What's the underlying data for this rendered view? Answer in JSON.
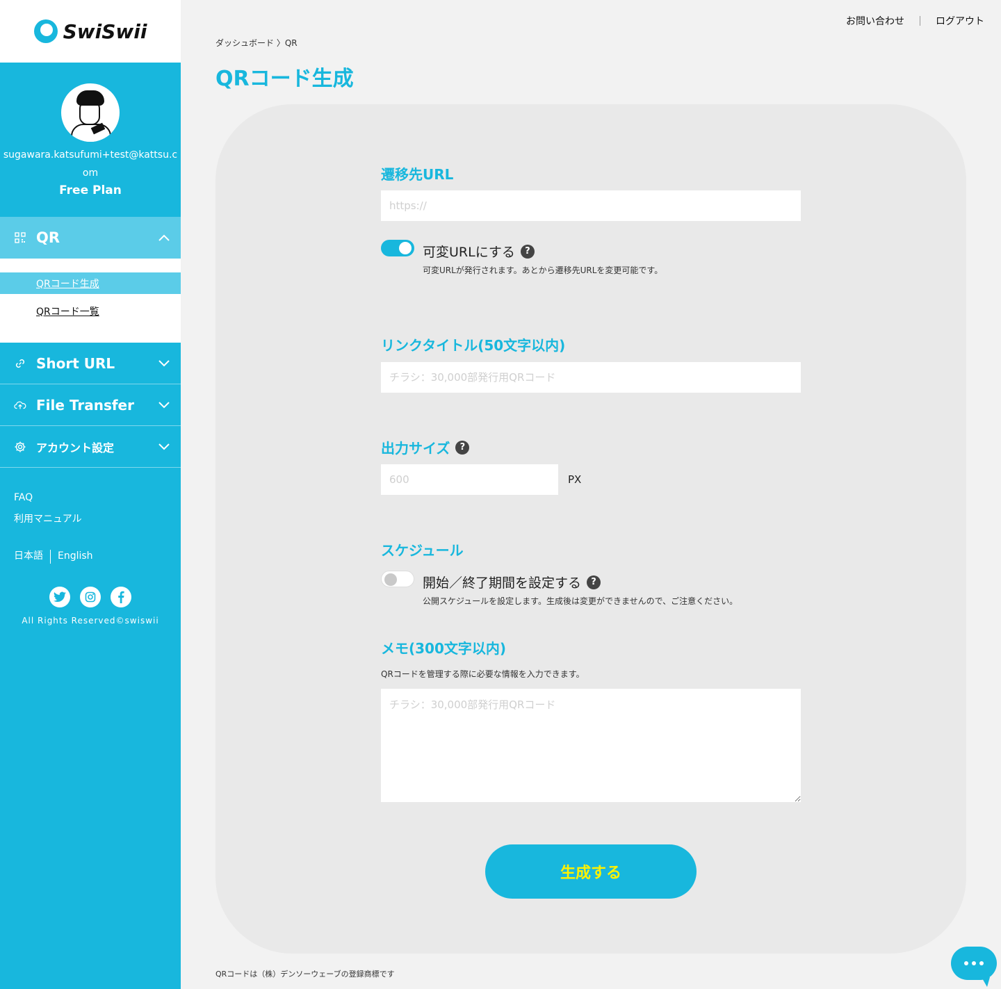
{
  "brand": {
    "name": "SwiSwii",
    "color": "#18b7dd"
  },
  "user": {
    "email": "sugawara.katsufumi+test@kattsu.com",
    "plan": "Free Plan"
  },
  "sidebar": {
    "qr": {
      "label": "QR",
      "icon": "qr-icon",
      "expanded": true
    },
    "qr_submenu": [
      {
        "label": "QRコード生成",
        "active": true
      },
      {
        "label": "QRコード一覧",
        "active": false
      }
    ],
    "items": [
      {
        "label": "Short URL",
        "icon": "link-icon"
      },
      {
        "label": "File Transfer",
        "icon": "cloud-upload-icon"
      },
      {
        "label": "アカウント設定",
        "icon": "gear-icon"
      }
    ],
    "links": [
      "FAQ",
      "利用マニュアル"
    ],
    "languages": [
      "日本語",
      "English"
    ],
    "social": [
      "twitter-icon",
      "instagram-icon",
      "facebook-icon"
    ],
    "copyright": "All Rights Reserved©swiswii"
  },
  "header": {
    "contact": "お問い合わせ",
    "logout": "ログアウト"
  },
  "breadcrumb": "ダッシュボード 〉QR",
  "page_title": "QRコード生成",
  "form": {
    "url_label": "遷移先URL",
    "url_placeholder": "https://",
    "variable_url_label": "可変URLにする",
    "variable_url_on": true,
    "variable_url_note": "可変URLが発行されます。あとから遷移先URLを変更可能です。",
    "title_label": "リンクタイトル(50文字以内)",
    "title_placeholder": "チラシ：30,000部発行用QRコード",
    "size_label": "出力サイズ",
    "size_placeholder": "600",
    "size_unit": "PX",
    "schedule_label": "スケジュール",
    "schedule_toggle_label": "開始／終了期間を設定する",
    "schedule_on": false,
    "schedule_note": "公開スケジュールを設定します。生成後は変更ができませんので、ご注意ください。",
    "memo_label": "メモ(300文字以内)",
    "memo_note": "QRコードを管理する際に必要な情報を入力できます。",
    "memo_placeholder": "チラシ：30,000部発行用QRコード",
    "submit": "生成する"
  },
  "footer_note": "QRコードは（株）デンソーウェーブの登録商標です"
}
